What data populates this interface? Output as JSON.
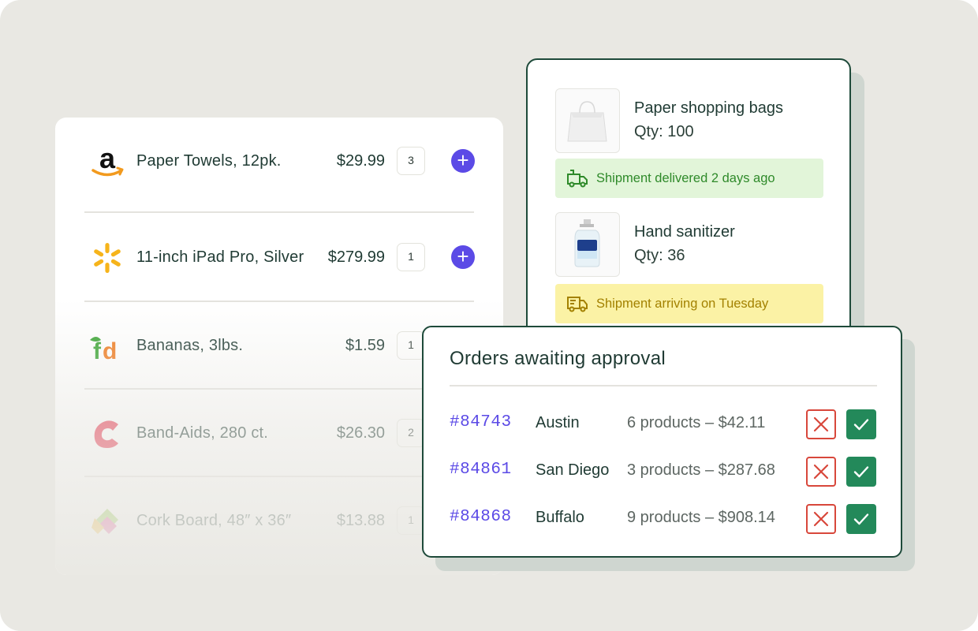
{
  "colors": {
    "brand_dark": "#1e4a3a",
    "accent_purple": "#5b4ae6",
    "delivered_bg": "#e2f5d9",
    "delivered_text": "#2f8a2a",
    "arriving_bg": "#fbf2a5",
    "arriving_text": "#a38100",
    "reject_red": "#d8473b",
    "approve_green": "#23895a"
  },
  "product_list": {
    "items": [
      {
        "logo": "amazon-logo",
        "name": "Paper Towels, 12pk.",
        "price": "$29.99",
        "qty": "3",
        "action_icon": "plus-icon"
      },
      {
        "logo": "walmart-logo",
        "name": "11-inch iPad Pro, Silver",
        "price": "$279.99",
        "qty": "1",
        "action_icon": "plus-icon"
      },
      {
        "logo": "freshdirect-logo",
        "name": "Bananas, 3lbs.",
        "price": "$1.59",
        "qty": "1"
      },
      {
        "logo": "staples-logo",
        "name": "Band-Aids, 280 ct.",
        "price": "$26.30",
        "qty": "2"
      },
      {
        "logo": "cork-logo",
        "name": "Cork Board, 48″ x 36″",
        "price": "$13.88",
        "qty": "1"
      }
    ]
  },
  "shipments": {
    "items": [
      {
        "thumbnail": "paper-bag-image",
        "title": "Paper shopping bags",
        "qty": "Qty: 100",
        "status": "Shipment delivered 2 days ago",
        "status_icon": "package-delivered-icon"
      },
      {
        "thumbnail": "sanitizer-bottle-image",
        "title": "Hand sanitizer",
        "qty": "Qty: 36",
        "status": "Shipment arriving on Tuesday",
        "status_icon": "delivery-truck-icon"
      }
    ]
  },
  "approvals": {
    "title": "Orders awaiting approval",
    "orders": [
      {
        "id": "#84743",
        "city": "Austin",
        "summary": "6 products – $42.11"
      },
      {
        "id": "#84861",
        "city": "San Diego",
        "summary": "3 products – $287.68"
      },
      {
        "id": "#84868",
        "city": "Buffalo",
        "summary": "9 products – $908.14"
      }
    ],
    "reject_icon": "x-icon",
    "approve_icon": "checkmark-icon"
  }
}
